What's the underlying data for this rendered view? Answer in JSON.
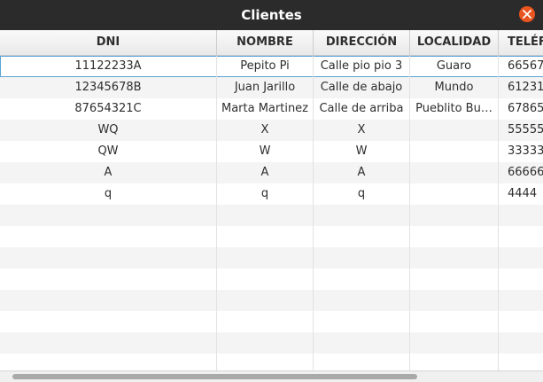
{
  "window": {
    "title": "Clientes"
  },
  "table": {
    "columns": [
      "DNI",
      "NOMBRE",
      "DIRECCIÓN",
      "LOCALIDAD",
      "TELÉFONO"
    ],
    "rows": [
      [
        "11122233A",
        "Pepito Pi",
        "Calle pio pio 3",
        "Guaro",
        "66567"
      ],
      [
        "12345678B",
        "Juan Jarillo",
        "Calle de abajo",
        "Mundo",
        "61231"
      ],
      [
        "87654321C",
        "Marta Martinez",
        "Calle de arriba",
        "Pueblito Bu…",
        "67865"
      ],
      [
        "WQ",
        "X",
        "X",
        "",
        "55555"
      ],
      [
        "QW",
        "W",
        "W",
        "",
        "33333"
      ],
      [
        "A",
        "A",
        "A",
        "",
        "66666"
      ],
      [
        "q",
        "q",
        "q",
        "",
        "4444"
      ]
    ],
    "empty_rows": 8
  }
}
